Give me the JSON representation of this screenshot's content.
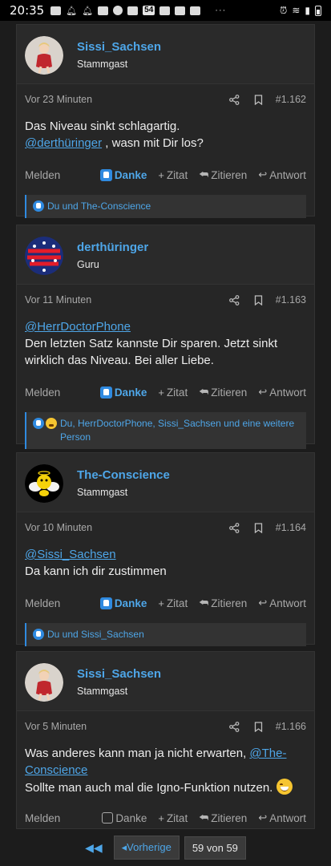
{
  "status_bar": {
    "time": "20:35",
    "badge": "54",
    "dots": "···"
  },
  "posts": [
    {
      "username": "Sissi_Sachsen",
      "usertitle": "Stammgast",
      "time": "Vor 23 Minuten",
      "number": "#1.162",
      "lines": [
        {
          "text": "Das Niveau sinkt schlagartig."
        },
        {
          "mention": "@derthüringer",
          "text": " , wasn mit Dir los?"
        }
      ],
      "reactions": "Du und The-Conscience",
      "danke_active": true
    },
    {
      "username": "derthüringer",
      "usertitle": "Guru",
      "time": "Vor 11 Minuten",
      "number": "#1.163",
      "lines": [
        {
          "mention": "@HerrDoctorPhone"
        },
        {
          "text": "Den letzten Satz kannste Dir sparen. Jetzt sinkt wirklich das Niveau. Bei aller Liebe."
        }
      ],
      "reactions": "Du, HerrDoctorPhone, Sissi_Sachsen und eine weitere Person",
      "danke_active": true
    },
    {
      "username": "The-Conscience",
      "usertitle": "Stammgast",
      "time": "Vor 10 Minuten",
      "number": "#1.164",
      "lines": [
        {
          "mention": "@Sissi_Sachsen"
        },
        {
          "text": "Da kann ich dir zustimmen"
        }
      ],
      "reactions": "Du und Sissi_Sachsen",
      "danke_active": true
    },
    {
      "username": "Sissi_Sachsen",
      "usertitle": "Stammgast",
      "time": "Vor 5 Minuten",
      "number": "#1.166",
      "line1_text": "Was anderes kann man ja nicht erwarten, ",
      "line1_mention": "@The-Conscience",
      "line2_text": "Sollte man auch mal die Igno-Funktion nutzen. ",
      "danke_active": false
    }
  ],
  "actions": {
    "report": "Melden",
    "thanks": "Danke",
    "quote_add": "Zitat",
    "quote": "Zitieren",
    "reply": "Antwort"
  },
  "icons": {
    "share": "share-icon",
    "bookmark": "bookmark-icon",
    "like": "thumbs-up-icon"
  },
  "pagination": {
    "first": "◀◀",
    "prev_label": "Vorherige",
    "current": "59 von 59"
  },
  "colors": {
    "accent": "#4ea6e8",
    "background": "#1c1c1c",
    "panel": "#262626"
  }
}
